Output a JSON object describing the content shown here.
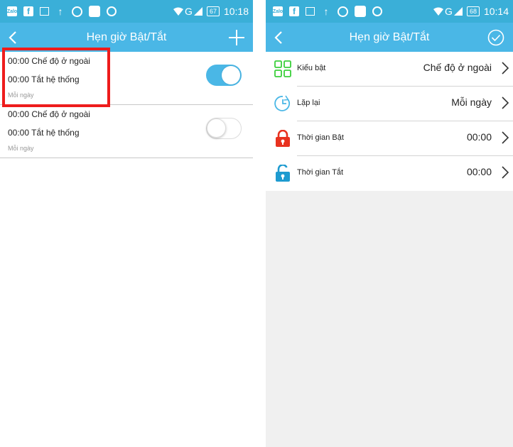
{
  "status_left": {
    "time": "10:18",
    "battery": "67",
    "network": "G",
    "zalo": "Zalo",
    "facebook": "f"
  },
  "status_right": {
    "time": "10:14",
    "battery": "68",
    "network": "G",
    "zalo": "Zalo",
    "facebook": "f"
  },
  "list_screen": {
    "title": "Hẹn giờ Bật/Tắt",
    "back_icon": "back-chevron-icon",
    "add_icon": "plus-icon",
    "timers": [
      {
        "on_line": "00:00 Chế độ ở ngoài",
        "off_line": "00:00 Tắt hệ thống",
        "repeat": "Mỗi ngày",
        "enabled": true
      },
      {
        "on_line": "00:00 Chế độ ở ngoài",
        "off_line": "00:00 Tắt hệ thống",
        "repeat": "Mỗi ngày",
        "enabled": false
      }
    ]
  },
  "detail_screen": {
    "title": "Hẹn giờ Bật/Tắt",
    "back_icon": "back-chevron-icon",
    "confirm_icon": "check-circle-icon",
    "rows": [
      {
        "icon": "grid-mode-icon",
        "label": "Kiểu bật",
        "value": "Chế độ ở ngoài"
      },
      {
        "icon": "clock-repeat-icon",
        "label": "Lặp lại",
        "value": "Mỗi ngày"
      },
      {
        "icon": "lock-closed-icon",
        "label": "Thời gian Bật",
        "value": "00:00"
      },
      {
        "icon": "lock-open-icon",
        "label": "Thời gian Tắt",
        "value": "00:00"
      }
    ]
  },
  "colors": {
    "status_bar": "#3aafd8",
    "toolbar": "#4ab7e6",
    "toggle_on": "#4ab7e6",
    "highlight": "#ee1c1c",
    "mode_icon": "#3bcf3b",
    "repeat_icon": "#4ab7e6",
    "lock_on_icon": "#e8321f",
    "lock_off_icon": "#1e9bd0"
  }
}
